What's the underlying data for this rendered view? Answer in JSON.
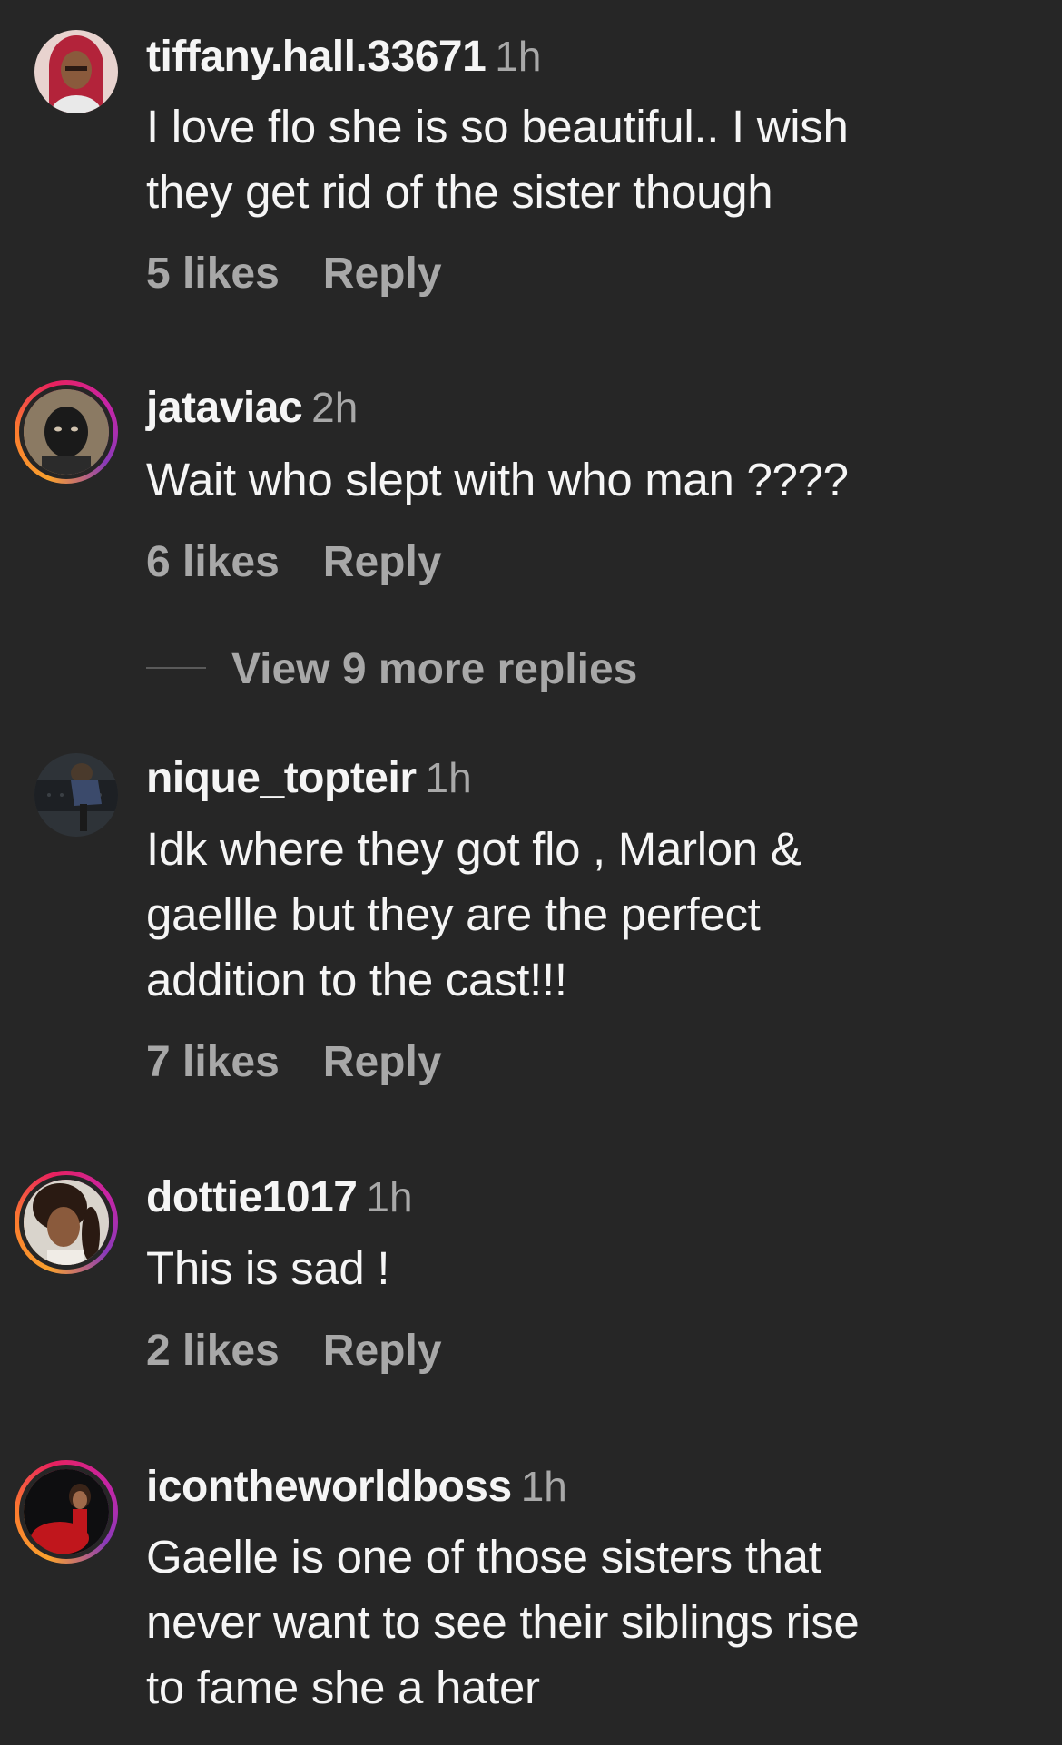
{
  "comments": [
    {
      "username": "tiffany.hall.33671",
      "time": "1h",
      "text": "I love flo she is so beautiful.. I wish\nthey get rid of the sister though",
      "likes": "5 likes",
      "reply": "Reply",
      "avatar_ring": false
    },
    {
      "username": "jataviac",
      "time": "2h",
      "text": "Wait who slept with who man ????",
      "likes": "6 likes",
      "reply": "Reply",
      "avatar_ring": true,
      "view_more": "View 9 more replies"
    },
    {
      "username": "nique_topteir",
      "time": "1h",
      "text": "Idk where they got flo , Marlon &\ngaellle but they are the perfect\naddition to the cast!!!",
      "likes": "7 likes",
      "reply": "Reply",
      "avatar_ring": false
    },
    {
      "username": "dottie1017",
      "time": "1h",
      "text": "This is sad !",
      "likes": "2 likes",
      "reply": "Reply",
      "avatar_ring": true
    },
    {
      "username": "icontheworldboss",
      "time": "1h",
      "text": "Gaelle is one of those sisters that\nnever want to see their siblings rise\nto fame she a hater",
      "avatar_ring": true
    }
  ],
  "colors": {
    "background": "#262626",
    "primary_text": "#f5f5f5",
    "secondary_text": "#a8a8a8",
    "story_ring": [
      "#f9a12e",
      "#e8215e",
      "#c724a6"
    ]
  }
}
